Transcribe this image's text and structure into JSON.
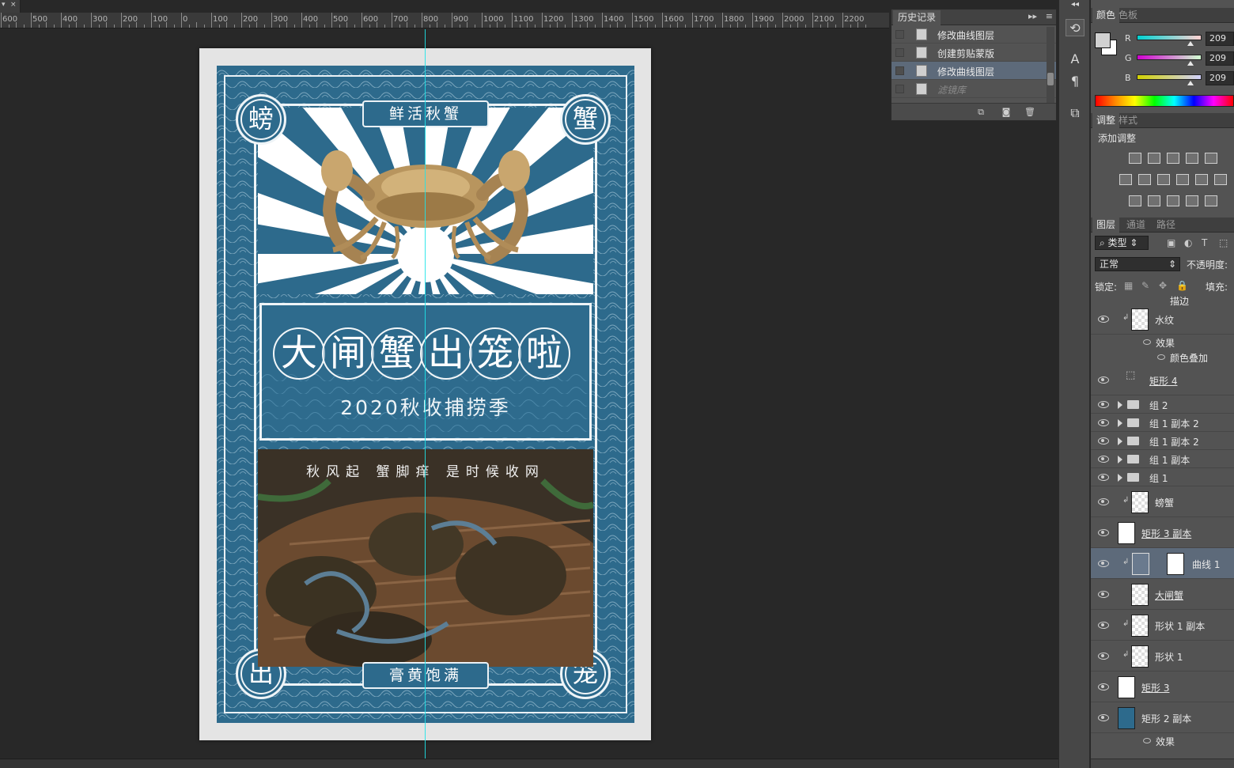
{
  "document": {
    "tab_close": "×",
    "ruler_labels": [
      "600",
      "500",
      "400",
      "300",
      "200",
      "100",
      "0",
      "100",
      "200",
      "300",
      "400",
      "500",
      "600",
      "700",
      "800",
      "900",
      "1000",
      "1100",
      "1200",
      "1300",
      "1400",
      "1500",
      "1600",
      "1700",
      "1800",
      "1900",
      "2000",
      "2100",
      "2200"
    ]
  },
  "poster": {
    "top_banner": "鲜活秋蟹",
    "bottom_banner": "膏黄饱满",
    "corner_tl": "螃",
    "corner_tr": "蟹",
    "corner_bl": "出",
    "corner_br": "笼",
    "title_chars": [
      "大",
      "闸",
      "蟹",
      "出",
      "笼",
      "啦"
    ],
    "subtitle": "2020秋收捕捞季",
    "photo_caption": "秋风起  蟹脚痒  是时候收网"
  },
  "history": {
    "tab": "历史记录",
    "items": [
      {
        "label": "修改曲线图层",
        "active": false,
        "dim": false
      },
      {
        "label": "创建剪贴蒙版",
        "active": false,
        "dim": false
      },
      {
        "label": "修改曲线图层",
        "active": true,
        "dim": false
      },
      {
        "label": "滤镜库",
        "active": false,
        "dim": true
      }
    ]
  },
  "color_panel": {
    "tabs": [
      "颜色",
      "色板"
    ],
    "fg_color": "#d1d1d1",
    "channels": [
      {
        "label": "R",
        "value": "209"
      },
      {
        "label": "G",
        "value": "209"
      },
      {
        "label": "B",
        "value": "209"
      }
    ]
  },
  "adjust_panel": {
    "tabs": [
      "调整",
      "样式"
    ],
    "title": "添加调整"
  },
  "layers_panel": {
    "tabs": [
      "图层",
      "通道",
      "路径"
    ],
    "filter_kind": "类型",
    "blend_mode": "正常",
    "opacity_label": "不透明度:",
    "lock_label": "锁定:",
    "fill_label": "填充:",
    "partial_top": "描边",
    "layers": [
      {
        "name": "水纹",
        "type": "pixel",
        "underline": false,
        "clip": true
      },
      {
        "name": "效果",
        "type": "effects"
      },
      {
        "name": "颜色叠加",
        "type": "effect"
      },
      {
        "name": "矩形 4",
        "type": "shape",
        "underline": true
      },
      {
        "name": "组 2",
        "type": "group"
      },
      {
        "name": "组 1 副本 2",
        "type": "group"
      },
      {
        "name": "组 1 副本 2",
        "type": "group"
      },
      {
        "name": "组 1 副本",
        "type": "group"
      },
      {
        "name": "组 1",
        "type": "group"
      },
      {
        "name": "螃蟹",
        "type": "pixel",
        "clip": true
      },
      {
        "name": "矩形 3 副本",
        "type": "shape",
        "underline": true
      },
      {
        "name": "曲线 1",
        "type": "adjustment",
        "selected": true,
        "clip": true
      },
      {
        "name": "大闸蟹",
        "type": "pixel",
        "underline": true
      },
      {
        "name": "形状 1 副本",
        "type": "pixel",
        "clip": true
      },
      {
        "name": "形状 1",
        "type": "pixel",
        "clip": true
      },
      {
        "name": "矩形 3",
        "type": "shape",
        "underline": true
      },
      {
        "name": "矩形 2 副本",
        "type": "shape"
      },
      {
        "name": "效果",
        "type": "effects"
      }
    ]
  }
}
